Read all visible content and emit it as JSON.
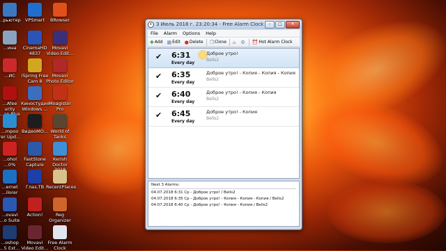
{
  "desktop_icons": [
    {
      "label": "...рьютер",
      "color": "#3a78c2"
    },
    {
      "label": "VPSmart",
      "color": "#1e6fd0"
    },
    {
      "label": "BRowser",
      "color": "#e0501a"
    },
    {
      "label": "...ина",
      "color": "#8aa4c0"
    },
    {
      "label": "CinemaHD\n4837",
      "color": "#2b54b8"
    },
    {
      "label": "Movavi\nVideo Edit...",
      "color": "#3a2f7a"
    },
    {
      "label": "...ИС",
      "color": "#cc2a2a"
    },
    {
      "label": "iSpring Free\nCam 8",
      "color": "#d3a61f"
    },
    {
      "label": "Movavi\nPhoto Editor",
      "color": "#b02828"
    },
    {
      "label": "...Afee\nurity\n...an Plus",
      "color": "#b01010"
    },
    {
      "label": "Киностудия\nWindows ...",
      "color": "#3c6ebf"
    },
    {
      "label": "Moagister\nPro",
      "color": "#c33018"
    },
    {
      "label": "...mpoo\nrer Upd...",
      "color": "#2a8ed0"
    },
    {
      "label": "ВидеоМО...",
      "color": "#1d1d1d"
    },
    {
      "label": "World of\nTanks",
      "color": "#5a4630"
    },
    {
      "label": "...ohol\n...0%",
      "color": "#cc2222"
    },
    {
      "label": "FastStone\nCapture",
      "color": "#2b5aa8"
    },
    {
      "label": "Kerish Doctor\n2018",
      "color": "#3d8fd6"
    },
    {
      "label": "...ernet\n...ilorer",
      "color": "#1d6fc2"
    },
    {
      "label": "Глаз.ТВ",
      "color": "#1e3fa8"
    },
    {
      "label": "RecentPlaces",
      "color": "#d8c18a"
    },
    {
      "label": "...ovavi\n...o Suite",
      "color": "#2b58b0"
    },
    {
      "label": "Action!",
      "color": "#c02020"
    },
    {
      "label": "Reg\nOrganizer",
      "color": "#d0642a"
    },
    {
      "label": "...oshop\n...5 Ext...",
      "color": "#1f3c73"
    },
    {
      "label": "Movavi\nVideo Edit...",
      "color": "#6a2630"
    },
    {
      "label": "Free Alarm\nClock",
      "color": "#dfe6ee"
    }
  ],
  "window": {
    "title": "3 Июль 2018 г. 23:20:34 - Free Alarm Clock",
    "controls": {
      "minimize": "–",
      "maximize": "□",
      "close": "✕"
    }
  },
  "menu": [
    "File",
    "Alarm",
    "Options",
    "Help"
  ],
  "toolbar": {
    "add": "Add",
    "edit": "Edit",
    "delete": "Delete",
    "clone": "Clone",
    "hot_alarm": "Hot Alarm Clock"
  },
  "alarms": [
    {
      "time": "6:31",
      "repeat": "Every day",
      "name": "Доброе утро!",
      "sound": "Bells2",
      "selected": true
    },
    {
      "time": "6:35",
      "repeat": "Every day",
      "name": "Доброе утро! - Копия - Копия - Копия",
      "sound": "Bells2",
      "selected": false
    },
    {
      "time": "6:40",
      "repeat": "Every day",
      "name": "Доброе утро! - Копия - Копия",
      "sound": "Bells2",
      "selected": false
    },
    {
      "time": "6:45",
      "repeat": "Every day",
      "name": "Доброе утро! - Копия",
      "sound": "Bells2",
      "selected": false
    }
  ],
  "next_alarms": {
    "title": "Next 3 Alarms:",
    "items": [
      "04.07.2018 6:31 Ср - Доброе утро! / Bells2",
      "04.07.2018 6:35 Ср - Доброе утро! - Копия - Копия - Копия / Bells2",
      "04.07.2018 6:40 Ср - Доброе утро! - Копия - Копия / Bells2"
    ]
  }
}
